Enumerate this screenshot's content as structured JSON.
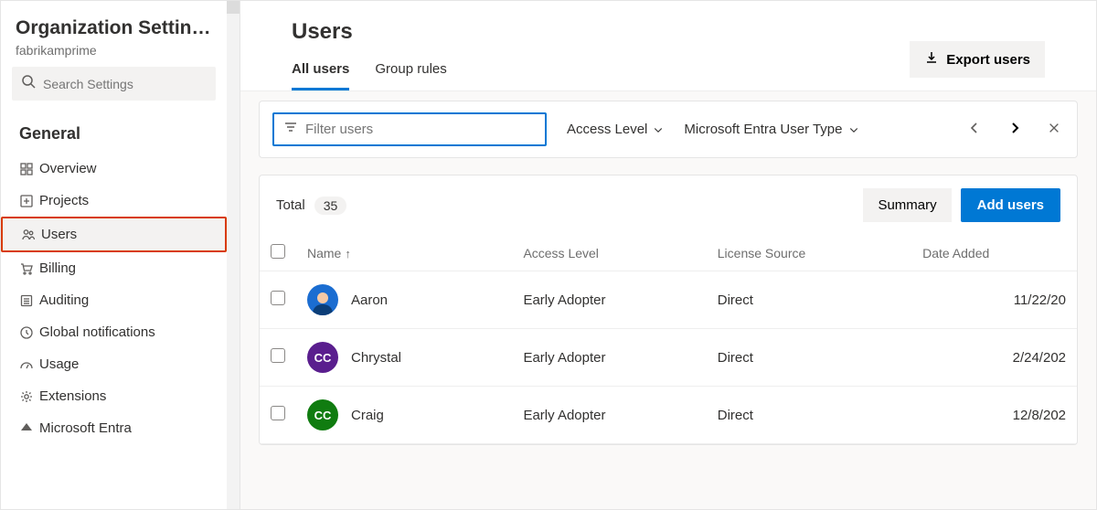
{
  "sidebar": {
    "title": "Organization Settin…",
    "subtitle": "fabrikamprime",
    "search_placeholder": "Search Settings",
    "section": "General",
    "items": [
      {
        "icon": "grid-icon",
        "label": "Overview"
      },
      {
        "icon": "plus-box-icon",
        "label": "Projects"
      },
      {
        "icon": "users-icon",
        "label": "Users",
        "active": true,
        "highlighted": true
      },
      {
        "icon": "cart-icon",
        "label": "Billing"
      },
      {
        "icon": "list-icon",
        "label": "Auditing"
      },
      {
        "icon": "clock-icon",
        "label": "Global notifications"
      },
      {
        "icon": "meter-icon",
        "label": "Usage"
      },
      {
        "icon": "gear-icon",
        "label": "Extensions"
      },
      {
        "icon": "entra-icon",
        "label": "Microsoft Entra"
      }
    ]
  },
  "header": {
    "title": "Users",
    "tabs": [
      {
        "label": "All users",
        "active": true
      },
      {
        "label": "Group rules"
      }
    ],
    "export_label": "Export users"
  },
  "filters": {
    "placeholder": "Filter users",
    "access_level_label": "Access Level",
    "entra_label": "Microsoft Entra User Type"
  },
  "summary": {
    "total_label": "Total",
    "total_count": "35",
    "summary_btn": "Summary",
    "add_btn": "Add users"
  },
  "columns": {
    "name": "Name",
    "access": "Access Level",
    "source": "License Source",
    "date": "Date Added"
  },
  "rows": [
    {
      "avatar_type": "photo",
      "avatar_bg": "#1b6dd1",
      "initials": "",
      "name": "Aaron",
      "access": "Early Adopter",
      "source": "Direct",
      "date": "11/22/20"
    },
    {
      "avatar_type": "init",
      "avatar_bg": "#5a1e8e",
      "initials": "CC",
      "name": "Chrystal",
      "access": "Early Adopter",
      "source": "Direct",
      "date": "2/24/202"
    },
    {
      "avatar_type": "init",
      "avatar_bg": "#107c10",
      "initials": "CC",
      "name": "Craig",
      "access": "Early Adopter",
      "source": "Direct",
      "date": "12/8/202"
    }
  ]
}
